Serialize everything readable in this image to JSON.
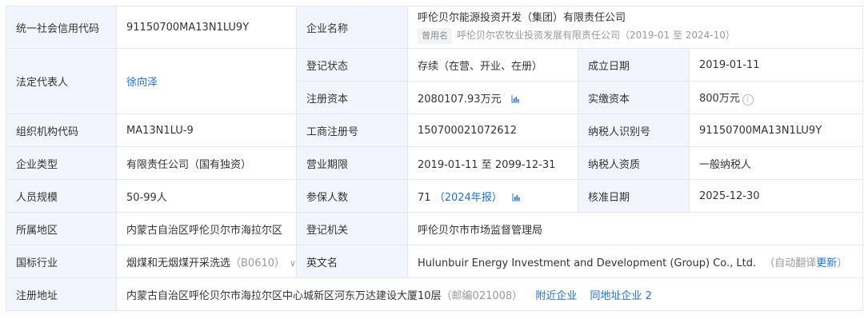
{
  "rows": {
    "credit_code": {
      "label": "统一社会信用代码",
      "value": "91150700MA13N1LU9Y"
    },
    "company_name": {
      "label": "企业名称",
      "value": "呼伦贝尔能源投资开发（集团）有限责任公司",
      "former_tag": "曾用名",
      "former_name": "呼伦贝尔农牧业投资发展有限责任公司（2019-01 至 2024-10）"
    },
    "legal_rep": {
      "label": "法定代表人",
      "value": "徐向泽"
    },
    "reg_status": {
      "label": "登记状态",
      "value": "存续（在营、开业、在册）"
    },
    "found_date": {
      "label": "成立日期",
      "value": "2019-01-11"
    },
    "reg_capital": {
      "label": "注册资本",
      "value": "2080107.93万元"
    },
    "paid_capital": {
      "label": "实缴资本",
      "value": "800万元"
    },
    "org_code": {
      "label": "组织机构代码",
      "value": "MA13N1LU-9"
    },
    "biz_reg_no": {
      "label": "工商注册号",
      "value": "150700021072612"
    },
    "taxpayer_id": {
      "label": "纳税人识别号",
      "value": "91150700MA13N1LU9Y"
    },
    "company_type": {
      "label": "企业类型",
      "value": "有限责任公司（国有独资）"
    },
    "biz_term": {
      "label": "营业期限",
      "value": "2019-01-11 至 2099-12-31"
    },
    "taxpayer_qual": {
      "label": "纳税人资质",
      "value": "一般纳税人"
    },
    "staff_size": {
      "label": "人员规模",
      "value": "50-99人"
    },
    "insured": {
      "label": "参保人数",
      "value": "71",
      "report": "（2024年报）"
    },
    "approval_date": {
      "label": "核准日期",
      "value": "2025-12-30"
    },
    "region": {
      "label": "所属地区",
      "value": "内蒙古自治区呼伦贝尔市海拉尔区"
    },
    "reg_authority": {
      "label": "登记机关",
      "value": "呼伦贝尔市市场监督管理局"
    },
    "industry": {
      "label": "国标行业",
      "value": "烟煤和无烟煤开采洗选",
      "code": "（B0610）",
      "chevron": "∨"
    },
    "english_name": {
      "label": "英文名",
      "value": "Hulunbuir Energy Investment and Development (Group) Co., Ltd.",
      "auto_prefix": "（自动翻译",
      "update_link": "更新",
      "auto_suffix": "）"
    },
    "reg_address": {
      "label": "注册地址",
      "value": "内蒙古自治区呼伦贝尔市海拉尔区中心城新区河东万达建设大厦10层",
      "postcode": "（邮编021008）",
      "nearby_link": "附近企业",
      "same_addr_link": "同地址企业 2"
    }
  },
  "icons": {
    "chart": "bar-chart-icon",
    "info": "info-circle-icon",
    "chevron": "chevron-down-icon"
  },
  "colors": {
    "label_bg": "#f2f5fb",
    "border": "#e4e7ed",
    "link": "#1f6fd6",
    "muted": "#999999"
  }
}
